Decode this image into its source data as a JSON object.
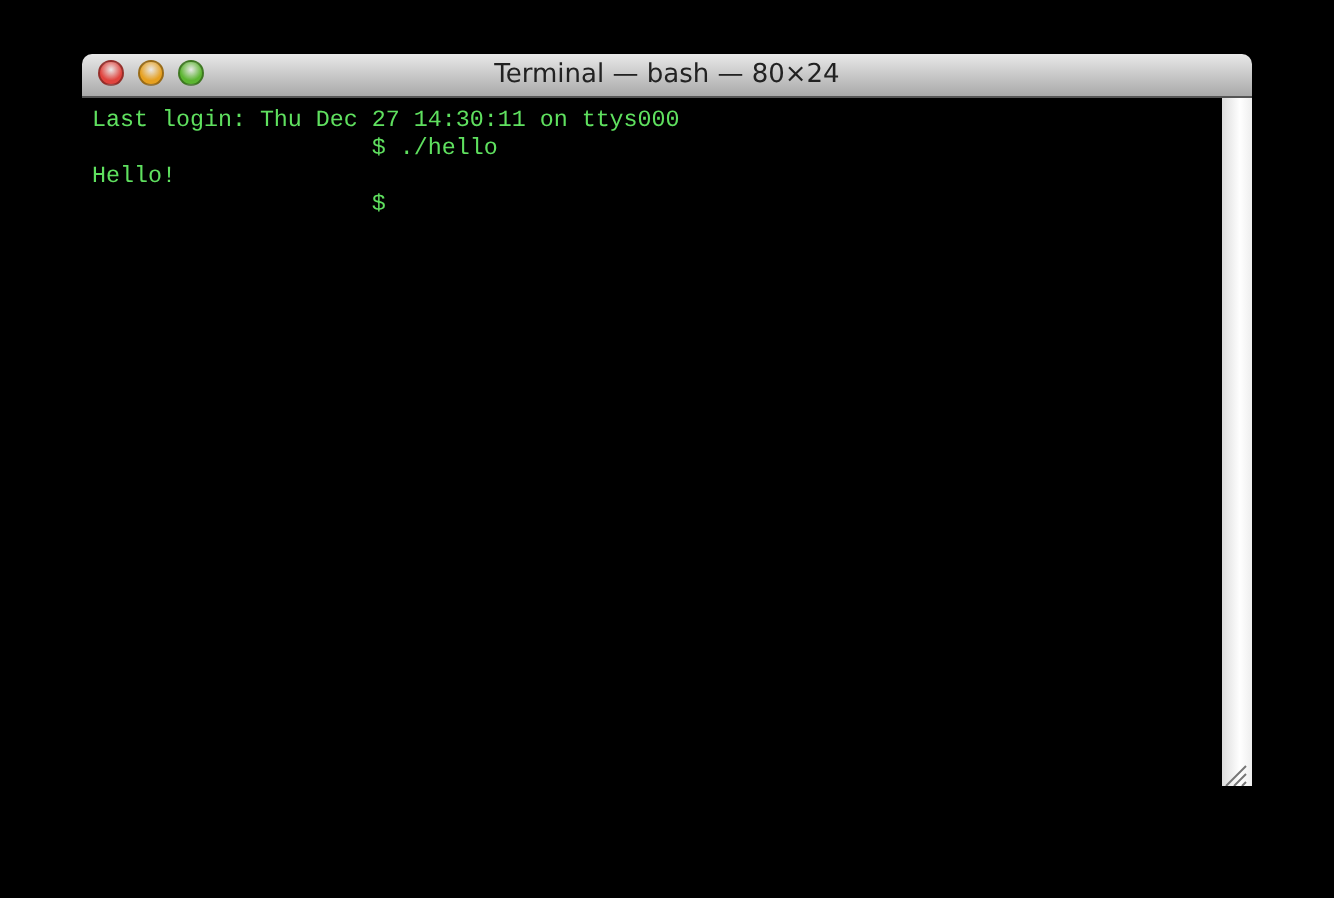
{
  "window": {
    "title": "Terminal — bash — 80×24"
  },
  "lines": [
    {
      "kind": "output",
      "text": "Last login: Thu Dec 27 14:30:11 on ttys000"
    },
    {
      "kind": "prompt",
      "text": "$ ./hello"
    },
    {
      "kind": "output",
      "text": "Hello!"
    },
    {
      "kind": "prompt",
      "text": "$"
    }
  ]
}
